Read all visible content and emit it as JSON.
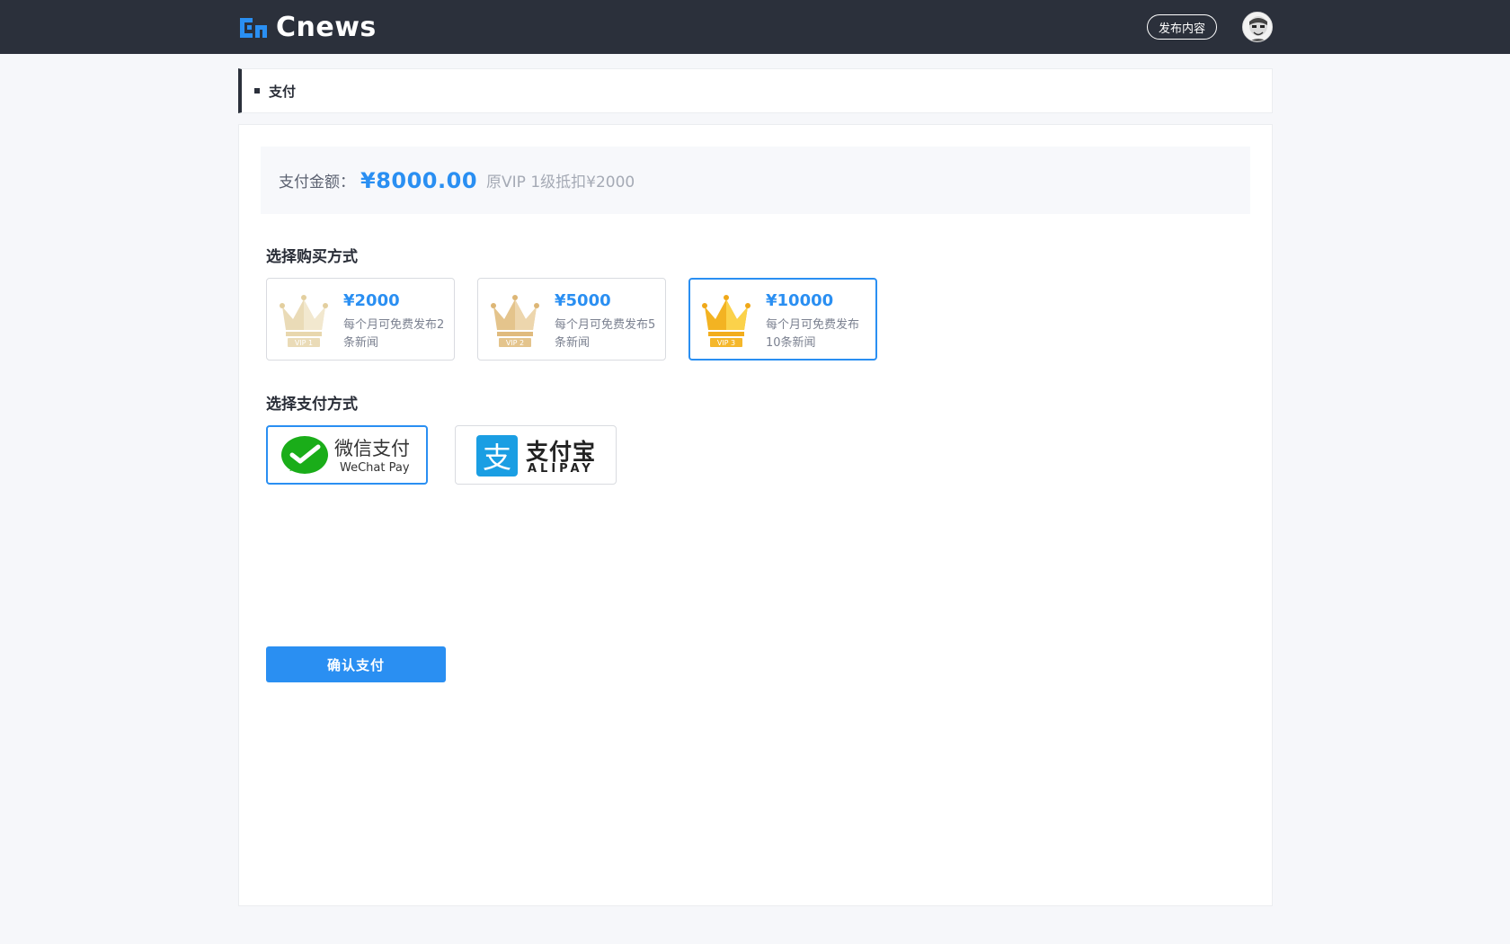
{
  "header": {
    "logo_text": "Cnews",
    "publish_label": "发布内容"
  },
  "breadcrumb": {
    "title": "支付"
  },
  "payment": {
    "amount_label": "支付金额：",
    "amount_value": "¥8000.00",
    "amount_note": "原VIP 1级抵扣¥2000"
  },
  "purchase": {
    "title": "选择购买方式",
    "options": [
      {
        "badge": "VIP 1",
        "price": "¥2000",
        "desc": "每个月可免费发布2条新闻",
        "selected": false
      },
      {
        "badge": "VIP 2",
        "price": "¥5000",
        "desc": "每个月可免费发布5条新闻",
        "selected": false
      },
      {
        "badge": "VIP 3",
        "price": "¥10000",
        "desc": "每个月可免费发布10条新闻",
        "selected": true
      }
    ]
  },
  "pay_method": {
    "title": "选择支付方式",
    "wechat": {
      "name": "微信支付",
      "sub": "WeChat Pay",
      "selected": true
    },
    "alipay": {
      "glyph": "支",
      "name": "支付宝",
      "sub": "ALIPAY",
      "selected": false
    }
  },
  "confirm_label": "确认支付",
  "colors": {
    "accent": "#2a8ff2",
    "topbar": "#2b303b",
    "wechat_green": "#1aad19",
    "alipay_blue": "#1a9ee3",
    "gold": "#f5b72a"
  }
}
